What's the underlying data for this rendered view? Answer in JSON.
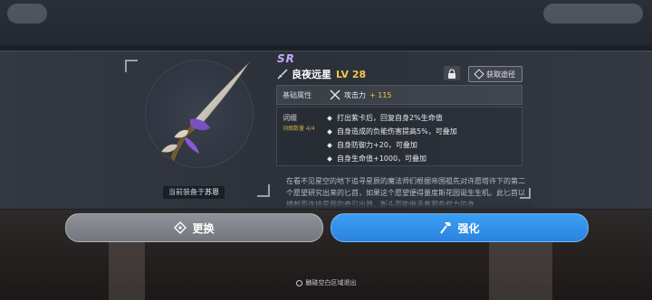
{
  "weapon": {
    "rarity": "SR",
    "name": "良夜远星",
    "level": "LV 28",
    "equipped_prefix": "当前装备于",
    "equipped_name": "苏恩"
  },
  "actions": {
    "source_label": "获取途径",
    "swap_label": "更换",
    "upgrade_label": "强化"
  },
  "base_stats": {
    "label": "基础属性",
    "stat_name": "攻击力",
    "stat_value": "+ 115"
  },
  "affix": {
    "label": "词缀",
    "count": "词缀数量 4/4",
    "items": [
      "打出紫卡后，回复自身2%生命值",
      "自身造成的负能伤害提高5%，可叠加",
      "自身防御力+20，可叠加",
      "自身生命值+1000，可叠加"
    ]
  },
  "description": "在看不见星空的地下追寻星辰的魔法师们根据帝国祖先对许愿塔许下的第二个愿望研究出来的匕首，如果这个愿望便得量度斯花园诞生生机。此匕首以横截面连接星辰的牵引出器，断头而能继承着那些权力的身",
  "footer": {
    "exit_hint": "触碰空白区域退出"
  },
  "colors": {
    "rarity": "#c9a6ff",
    "level": "#f2c94c",
    "upgrade_button": "#2a83df",
    "swap_button": "#80848a"
  },
  "icons": [
    "sword-icon",
    "lock-icon",
    "diamond-icon",
    "attack-icon",
    "swap-icon",
    "hammer-icon"
  ]
}
